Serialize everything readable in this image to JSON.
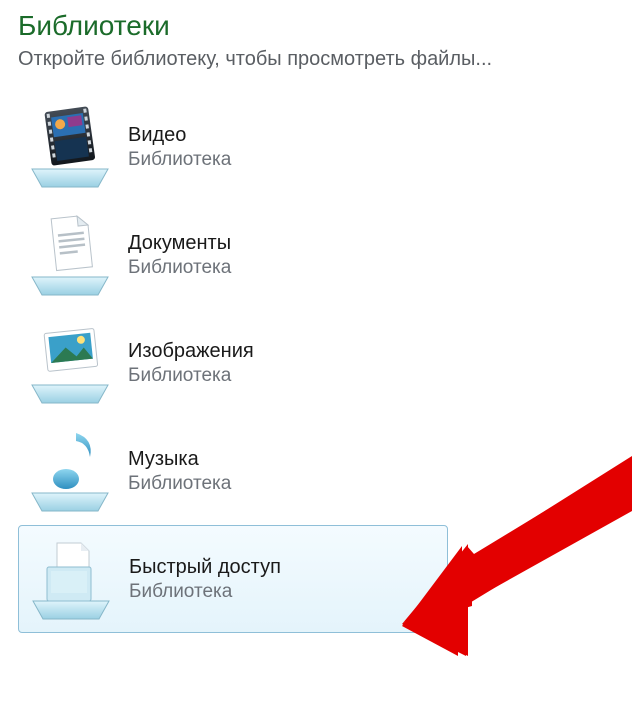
{
  "header": {
    "title": "Библиотеки",
    "subtitle": "Откройте библиотеку, чтобы просмотреть файлы..."
  },
  "libraries": {
    "type_label": "Библиотека",
    "items": [
      {
        "id": "videos",
        "name": "Видео",
        "icon": "video-library-icon",
        "selected": false
      },
      {
        "id": "documents",
        "name": "Документы",
        "icon": "document-library-icon",
        "selected": false
      },
      {
        "id": "pictures",
        "name": "Изображения",
        "icon": "picture-library-icon",
        "selected": false
      },
      {
        "id": "music",
        "name": "Музыка",
        "icon": "music-library-icon",
        "selected": false
      },
      {
        "id": "quick",
        "name": "Быстрый доступ",
        "icon": "generic-library-icon",
        "selected": true
      }
    ]
  },
  "annotation": {
    "arrow_target": "quick",
    "arrow_color": "#e30000"
  }
}
